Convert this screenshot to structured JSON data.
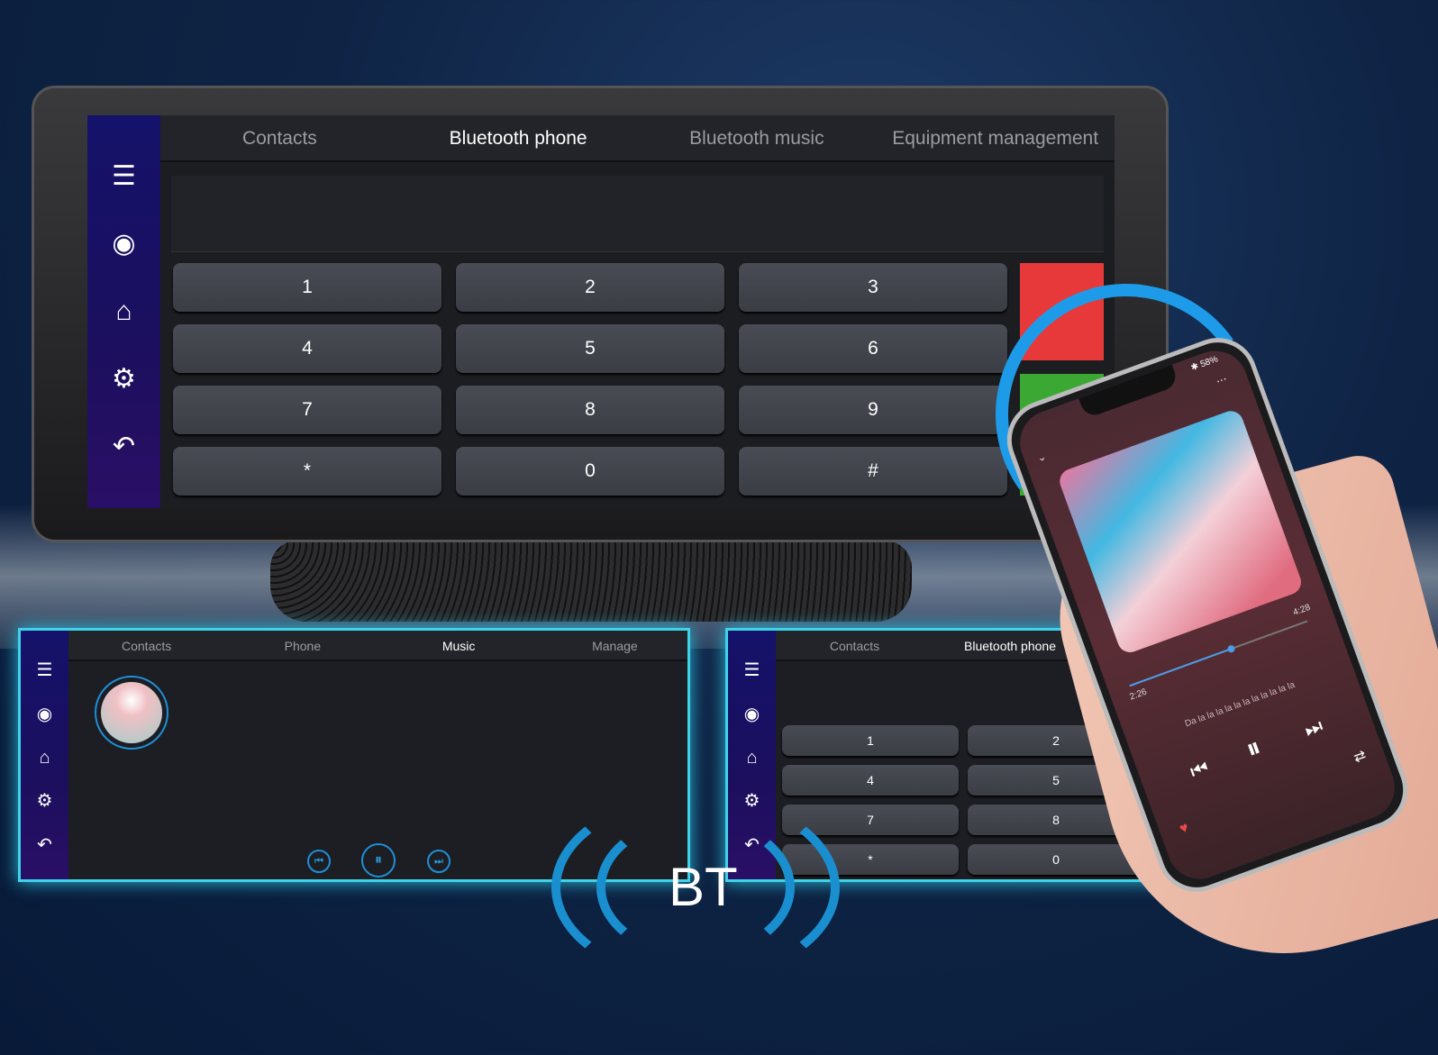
{
  "main_display": {
    "tabs": [
      {
        "label": "Contacts"
      },
      {
        "label": "Bluetooth phone",
        "active": true
      },
      {
        "label": "Bluetooth music"
      },
      {
        "label": "Equipment management"
      }
    ],
    "sidebar": [
      "menu-icon",
      "camera-icon",
      "home-icon",
      "gear-icon",
      "back-icon"
    ],
    "keys": [
      "1",
      "2",
      "3",
      "4",
      "5",
      "6",
      "7",
      "8",
      "9",
      "*",
      "0",
      "#"
    ],
    "hangup_color": "#e8393a",
    "call_color": "#3aa832"
  },
  "music_panel": {
    "tabs": [
      {
        "label": "Contacts"
      },
      {
        "label": "Phone"
      },
      {
        "label": "Music",
        "active": true
      },
      {
        "label": "Manage"
      }
    ]
  },
  "phone_panel": {
    "tabs": [
      {
        "label": "Contacts"
      },
      {
        "label": "Bluetooth phone",
        "active": true
      }
    ],
    "keys": [
      "1",
      "2",
      "4",
      "5",
      "7",
      "8",
      "*",
      "0"
    ]
  },
  "phone": {
    "battery": "58%",
    "elapsed": "2:26",
    "duration": "4:28",
    "progress": 0.57,
    "lyrics": "Da la la la la la la la la la la la"
  },
  "badge": {
    "label": "BT"
  },
  "accent": "#3fd2e8"
}
